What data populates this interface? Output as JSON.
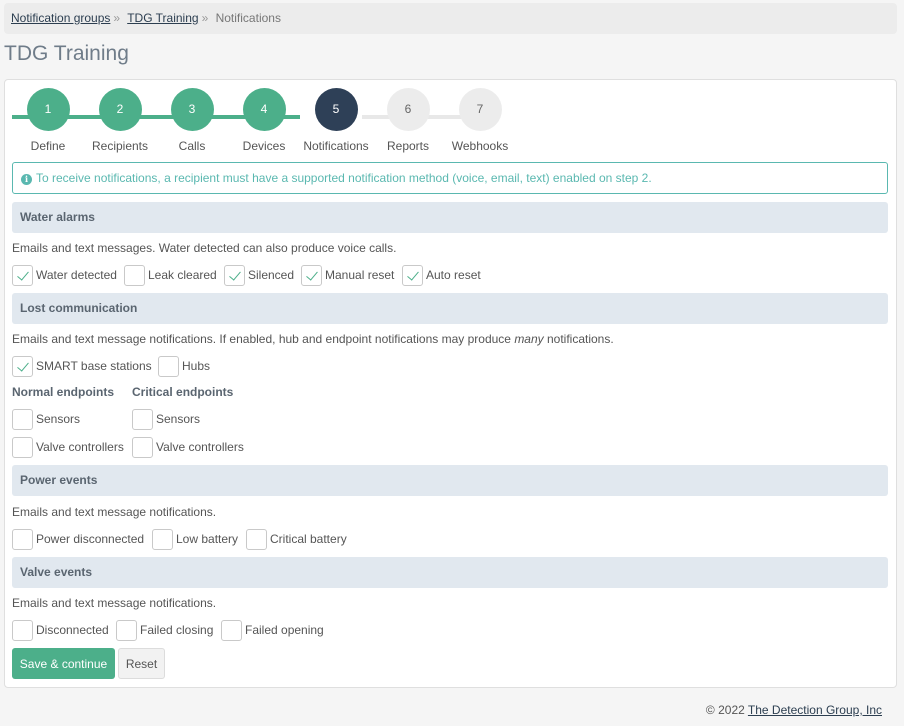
{
  "breadcrumb": {
    "items": [
      "Notification groups",
      "TDG Training"
    ],
    "current": "Notifications",
    "separator": "»"
  },
  "page": {
    "title": "TDG Training"
  },
  "stepper": {
    "steps": [
      {
        "number": "1",
        "label": "Define",
        "state": "done"
      },
      {
        "number": "2",
        "label": "Recipients",
        "state": "done"
      },
      {
        "number": "3",
        "label": "Calls",
        "state": "done"
      },
      {
        "number": "4",
        "label": "Devices",
        "state": "done"
      },
      {
        "number": "5",
        "label": "Notifications",
        "state": "current"
      },
      {
        "number": "6",
        "label": "Reports",
        "state": "todo"
      },
      {
        "number": "7",
        "label": "Webhooks",
        "state": "todo"
      }
    ]
  },
  "info": {
    "icon": "info-icon",
    "glyph": "i",
    "text": "To receive notifications, a recipient must have a supported notification method (voice, email, text) enabled on step 2."
  },
  "water": {
    "title": "Water alarms",
    "desc": "Emails and text messages. Water detected can also produce voice calls.",
    "options": [
      {
        "label": "Water detected",
        "checked": true
      },
      {
        "label": "Leak cleared",
        "checked": false
      },
      {
        "label": "Silenced",
        "checked": true
      },
      {
        "label": "Manual reset",
        "checked": true
      },
      {
        "label": "Auto reset",
        "checked": true
      }
    ]
  },
  "lost": {
    "title": "Lost communication",
    "desc_before": "Emails and text message notifications. If enabled, hub and endpoint notifications may produce ",
    "desc_em": "many",
    "desc_after": " notifications.",
    "options": [
      {
        "label": "SMART base stations",
        "checked": true
      },
      {
        "label": "Hubs",
        "checked": false
      }
    ],
    "normal": {
      "title": "Normal endpoints",
      "options": [
        {
          "label": "Sensors",
          "checked": false
        },
        {
          "label": "Valve controllers",
          "checked": false
        }
      ]
    },
    "critical": {
      "title": "Critical endpoints",
      "options": [
        {
          "label": "Sensors",
          "checked": false
        },
        {
          "label": "Valve controllers",
          "checked": false
        }
      ]
    }
  },
  "power": {
    "title": "Power events",
    "desc": "Emails and text message notifications.",
    "options": [
      {
        "label": "Power disconnected",
        "checked": false
      },
      {
        "label": "Low battery",
        "checked": false
      },
      {
        "label": "Critical battery",
        "checked": false
      }
    ]
  },
  "valve": {
    "title": "Valve events",
    "desc": "Emails and text message notifications.",
    "options": [
      {
        "label": "Disconnected",
        "checked": false
      },
      {
        "label": "Failed closing",
        "checked": false
      },
      {
        "label": "Failed opening",
        "checked": false
      }
    ]
  },
  "actions": {
    "save": "Save & continue",
    "reset": "Reset"
  },
  "footer": {
    "copyright": "© 2022",
    "company": "The Detection Group, Inc"
  },
  "colors": {
    "accent": "#4caf8a",
    "current_step": "#2e4057",
    "info": "#5ab8b0",
    "section_header": "#e1e8ef"
  }
}
